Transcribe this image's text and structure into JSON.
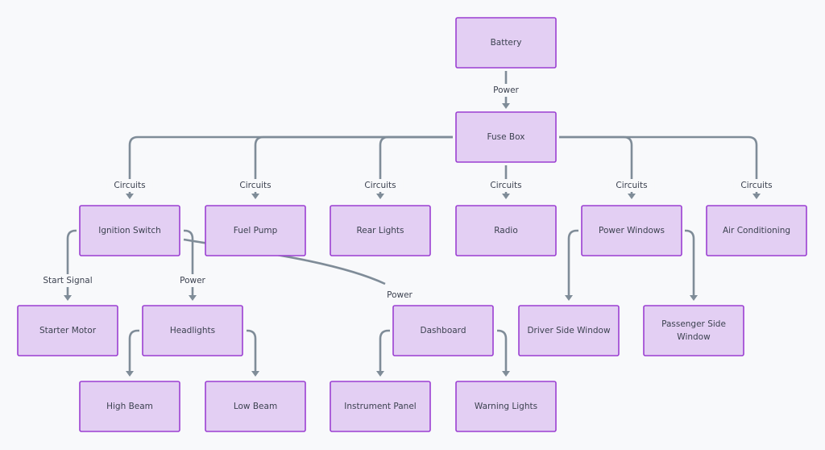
{
  "diagram": {
    "type": "flowchart",
    "colors": {
      "node_fill": "#e3cff3",
      "node_stroke": "#9b3fd2",
      "edge": "#7f8c98",
      "text": "#3c4250",
      "background": "#f8f9fb"
    },
    "nodes": [
      {
        "id": "battery",
        "label": "Battery"
      },
      {
        "id": "fuse_box",
        "label": "Fuse Box"
      },
      {
        "id": "ignition_switch",
        "label": "Ignition Switch"
      },
      {
        "id": "fuel_pump",
        "label": "Fuel Pump"
      },
      {
        "id": "rear_lights",
        "label": "Rear Lights"
      },
      {
        "id": "radio",
        "label": "Radio"
      },
      {
        "id": "power_windows",
        "label": "Power Windows"
      },
      {
        "id": "air_conditioning",
        "label": "Air Conditioning"
      },
      {
        "id": "starter_motor",
        "label": "Starter Motor"
      },
      {
        "id": "headlights",
        "label": "Headlights"
      },
      {
        "id": "dashboard",
        "label": "Dashboard"
      },
      {
        "id": "driver_side_window",
        "label": "Driver Side Window"
      },
      {
        "id": "passenger_side_window",
        "label": [
          "Passenger Side",
          "Window"
        ]
      },
      {
        "id": "high_beam",
        "label": "High Beam"
      },
      {
        "id": "low_beam",
        "label": "Low Beam"
      },
      {
        "id": "instrument_panel",
        "label": "Instrument Panel"
      },
      {
        "id": "warning_lights",
        "label": "Warning Lights"
      }
    ],
    "edges": [
      {
        "from": "battery",
        "to": "fuse_box",
        "label": "Power"
      },
      {
        "from": "fuse_box",
        "to": "ignition_switch",
        "label": "Circuits"
      },
      {
        "from": "fuse_box",
        "to": "fuel_pump",
        "label": "Circuits"
      },
      {
        "from": "fuse_box",
        "to": "rear_lights",
        "label": "Circuits"
      },
      {
        "from": "fuse_box",
        "to": "radio",
        "label": "Circuits"
      },
      {
        "from": "fuse_box",
        "to": "power_windows",
        "label": "Circuits"
      },
      {
        "from": "fuse_box",
        "to": "air_conditioning",
        "label": "Circuits"
      },
      {
        "from": "ignition_switch",
        "to": "starter_motor",
        "label": "Start Signal"
      },
      {
        "from": "ignition_switch",
        "to": "headlights",
        "label": "Power"
      },
      {
        "from": "ignition_switch",
        "to": "dashboard",
        "label": "Power"
      },
      {
        "from": "power_windows",
        "to": "driver_side_window",
        "label": ""
      },
      {
        "from": "power_windows",
        "to": "passenger_side_window",
        "label": ""
      },
      {
        "from": "headlights",
        "to": "high_beam",
        "label": ""
      },
      {
        "from": "headlights",
        "to": "low_beam",
        "label": ""
      },
      {
        "from": "dashboard",
        "to": "instrument_panel",
        "label": ""
      },
      {
        "from": "dashboard",
        "to": "warning_lights",
        "label": ""
      }
    ]
  }
}
